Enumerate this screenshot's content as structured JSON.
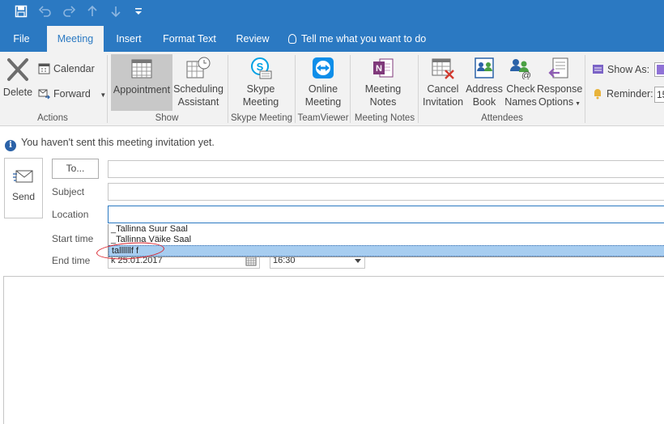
{
  "quick_access": {
    "save_icon": "save-icon",
    "undo_icon": "undo-icon",
    "redo_icon": "redo-icon",
    "up_icon": "arrow-up-icon",
    "down_icon": "arrow-down-icon",
    "customize_icon": "customize-quick-access-icon"
  },
  "tabs": [
    {
      "label": "File"
    },
    {
      "label": "Meeting"
    },
    {
      "label": "Insert"
    },
    {
      "label": "Format Text"
    },
    {
      "label": "Review"
    },
    {
      "label": "Tell me what you want to do"
    }
  ],
  "ribbon": {
    "actions": {
      "delete": "Delete",
      "calendar": "Calendar",
      "forward": "Forward",
      "group": "Actions"
    },
    "show": {
      "appointment": "Appointment",
      "scheduling_1": "Scheduling",
      "scheduling_2": "Assistant",
      "group": "Show"
    },
    "skype": {
      "line1": "Skype",
      "line2": "Meeting",
      "group": "Skype Meeting"
    },
    "teamviewer": {
      "line1": "Online",
      "line2": "Meeting",
      "group": "TeamViewer"
    },
    "notes": {
      "line1": "Meeting",
      "line2": "Notes",
      "group": "Meeting Notes"
    },
    "attendees": {
      "cancel_1": "Cancel",
      "cancel_2": "Invitation",
      "address_1": "Address",
      "address_2": "Book",
      "check_1": "Check",
      "check_2": "Names",
      "response_1": "Response",
      "response_2": "Options",
      "group": "Attendees"
    },
    "options": {
      "show_as": "Show As:",
      "reminder": "Reminder:",
      "reminder_value": "15"
    }
  },
  "info_bar": "You haven't sent this meeting invitation yet.",
  "form": {
    "send": "Send",
    "to": "To...",
    "subject": "Subject",
    "location": "Location",
    "start_time": "Start time",
    "end_time": "End time",
    "end_date": "k 25.01.2017",
    "end_time_value": "16:30"
  },
  "location_suggestions": [
    {
      "label": "_Tallinna Suur Saal"
    },
    {
      "label": "_Tallinna Väike Saal"
    },
    {
      "label": "tallllllf f"
    }
  ],
  "colors": {
    "accent": "#2b79c2",
    "ribbon_bg": "#f2f2f2",
    "highlight": "#a7cdf0",
    "annotation": "#d9232d"
  }
}
